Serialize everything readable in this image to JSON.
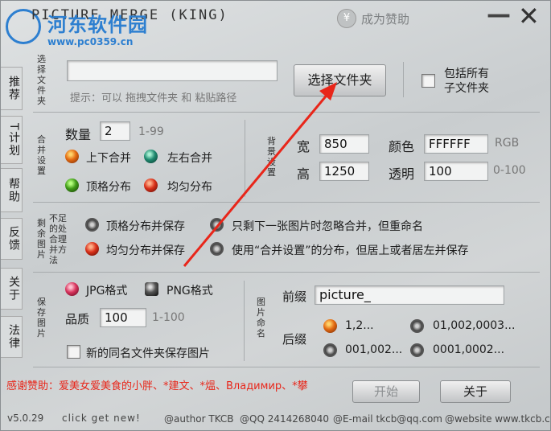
{
  "window": {
    "title": "PICTURE MERGE (KING)",
    "watermark_cn": "河东软件园",
    "watermark_url": "www.pc0359.cn",
    "donate_label": "成为赞助",
    "minimize_glyph": "—",
    "close_glyph": "✕"
  },
  "sidebar": {
    "tabs": [
      {
        "label": "推荐"
      },
      {
        "label": "T计划"
      },
      {
        "label": "帮助"
      },
      {
        "label": "反馈"
      },
      {
        "label": "关于"
      },
      {
        "label": "法律"
      }
    ]
  },
  "file_select": {
    "section_label": "选择文件夹",
    "path_value": "",
    "hint": "提示：可以 拖拽文件夹 和 粘贴路径",
    "select_button": "选择文件夹",
    "include_subfolders_label": "包括所有子文件夹",
    "include_subfolders_checked": false
  },
  "merge_settings": {
    "section_label": "合并设置",
    "count_label": "数量",
    "count_value": "2",
    "count_range": "1-99",
    "options": [
      {
        "label": "上下合并",
        "color": "orange",
        "selected": true
      },
      {
        "label": "左右合并",
        "color": "teal",
        "selected": false
      },
      {
        "label": "顶格分布",
        "color": "green",
        "selected": false
      },
      {
        "label": "均匀分布",
        "color": "red",
        "selected": false
      }
    ]
  },
  "background": {
    "section_label": "背景设置",
    "width_label": "宽",
    "width_value": "850",
    "height_label": "高",
    "height_value": "1250",
    "color_label": "颜色",
    "color_value": "FFFFFF",
    "color_unit": "RGB",
    "alpha_label": "透明",
    "alpha_value": "100",
    "alpha_range": "0-100"
  },
  "leftover": {
    "section_label": "剩余图片",
    "sub_label": "不足的处合理并方法",
    "options": [
      {
        "label": "顶格分布并保存"
      },
      {
        "label": "只剩下一张图片时忽略合并，但重命名"
      },
      {
        "label": "均匀分布并保存"
      },
      {
        "label": "使用“合并设置”的分布，但居上或者居左并保存"
      }
    ]
  },
  "save": {
    "section_label": "保存图片",
    "jpg_label": "JPG格式",
    "png_label": "PNG格式",
    "quality_label": "品质",
    "quality_value": "100",
    "quality_range": "1-100",
    "new_folder_label": "新的同名文件夹保存图片"
  },
  "naming": {
    "section_label": "图片命名",
    "prefix_label": "前缀",
    "prefix_value": "picture_",
    "suffix_label": "后缀",
    "suffix_options": [
      {
        "label": "1,2..."
      },
      {
        "label": "01,002,0003..."
      },
      {
        "label": "001,002..."
      },
      {
        "label": "0001,0002..."
      }
    ]
  },
  "actions": {
    "thanks": "感谢赞助：爱美女爱美食的小胖、*建文、*熅、Владимир、*攀",
    "start_button": "开始",
    "close_button": "关于"
  },
  "footer": {
    "version": "v5.0.29",
    "slogan": "click get new!",
    "author": "@author TKCB",
    "qq": "@QQ 2414268040",
    "email": "@E-mail tkcb@qq.com",
    "website": "@website www.tkcb.cc"
  },
  "colors": {
    "thanks_text": "#e8261a",
    "arrow": "#e8261a",
    "watermark": "#2d7fd0"
  }
}
